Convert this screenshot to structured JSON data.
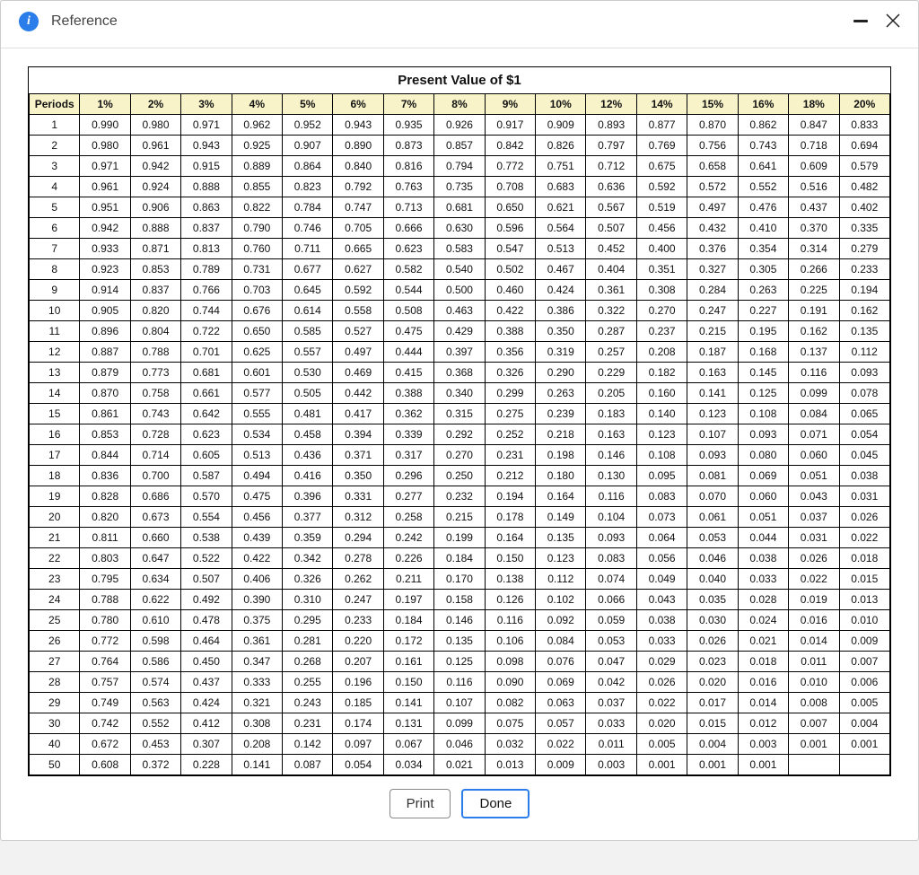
{
  "dialog": {
    "title": "Reference"
  },
  "table": {
    "title": "Present Value of $1",
    "periods_header": "Periods",
    "rates": [
      "1%",
      "2%",
      "3%",
      "4%",
      "5%",
      "6%",
      "7%",
      "8%",
      "9%",
      "10%",
      "12%",
      "14%",
      "15%",
      "16%",
      "18%",
      "20%"
    ],
    "rows": [
      {
        "period": "1",
        "values": [
          "0.990",
          "0.980",
          "0.971",
          "0.962",
          "0.952",
          "0.943",
          "0.935",
          "0.926",
          "0.917",
          "0.909",
          "0.893",
          "0.877",
          "0.870",
          "0.862",
          "0.847",
          "0.833"
        ]
      },
      {
        "period": "2",
        "values": [
          "0.980",
          "0.961",
          "0.943",
          "0.925",
          "0.907",
          "0.890",
          "0.873",
          "0.857",
          "0.842",
          "0.826",
          "0.797",
          "0.769",
          "0.756",
          "0.743",
          "0.718",
          "0.694"
        ]
      },
      {
        "period": "3",
        "values": [
          "0.971",
          "0.942",
          "0.915",
          "0.889",
          "0.864",
          "0.840",
          "0.816",
          "0.794",
          "0.772",
          "0.751",
          "0.712",
          "0.675",
          "0.658",
          "0.641",
          "0.609",
          "0.579"
        ]
      },
      {
        "period": "4",
        "values": [
          "0.961",
          "0.924",
          "0.888",
          "0.855",
          "0.823",
          "0.792",
          "0.763",
          "0.735",
          "0.708",
          "0.683",
          "0.636",
          "0.592",
          "0.572",
          "0.552",
          "0.516",
          "0.482"
        ]
      },
      {
        "period": "5",
        "values": [
          "0.951",
          "0.906",
          "0.863",
          "0.822",
          "0.784",
          "0.747",
          "0.713",
          "0.681",
          "0.650",
          "0.621",
          "0.567",
          "0.519",
          "0.497",
          "0.476",
          "0.437",
          "0.402"
        ]
      },
      {
        "period": "6",
        "values": [
          "0.942",
          "0.888",
          "0.837",
          "0.790",
          "0.746",
          "0.705",
          "0.666",
          "0.630",
          "0.596",
          "0.564",
          "0.507",
          "0.456",
          "0.432",
          "0.410",
          "0.370",
          "0.335"
        ]
      },
      {
        "period": "7",
        "values": [
          "0.933",
          "0.871",
          "0.813",
          "0.760",
          "0.711",
          "0.665",
          "0.623",
          "0.583",
          "0.547",
          "0.513",
          "0.452",
          "0.400",
          "0.376",
          "0.354",
          "0.314",
          "0.279"
        ]
      },
      {
        "period": "8",
        "values": [
          "0.923",
          "0.853",
          "0.789",
          "0.731",
          "0.677",
          "0.627",
          "0.582",
          "0.540",
          "0.502",
          "0.467",
          "0.404",
          "0.351",
          "0.327",
          "0.305",
          "0.266",
          "0.233"
        ]
      },
      {
        "period": "9",
        "values": [
          "0.914",
          "0.837",
          "0.766",
          "0.703",
          "0.645",
          "0.592",
          "0.544",
          "0.500",
          "0.460",
          "0.424",
          "0.361",
          "0.308",
          "0.284",
          "0.263",
          "0.225",
          "0.194"
        ]
      },
      {
        "period": "10",
        "values": [
          "0.905",
          "0.820",
          "0.744",
          "0.676",
          "0.614",
          "0.558",
          "0.508",
          "0.463",
          "0.422",
          "0.386",
          "0.322",
          "0.270",
          "0.247",
          "0.227",
          "0.191",
          "0.162"
        ]
      },
      {
        "period": "11",
        "values": [
          "0.896",
          "0.804",
          "0.722",
          "0.650",
          "0.585",
          "0.527",
          "0.475",
          "0.429",
          "0.388",
          "0.350",
          "0.287",
          "0.237",
          "0.215",
          "0.195",
          "0.162",
          "0.135"
        ]
      },
      {
        "period": "12",
        "values": [
          "0.887",
          "0.788",
          "0.701",
          "0.625",
          "0.557",
          "0.497",
          "0.444",
          "0.397",
          "0.356",
          "0.319",
          "0.257",
          "0.208",
          "0.187",
          "0.168",
          "0.137",
          "0.112"
        ]
      },
      {
        "period": "13",
        "values": [
          "0.879",
          "0.773",
          "0.681",
          "0.601",
          "0.530",
          "0.469",
          "0.415",
          "0.368",
          "0.326",
          "0.290",
          "0.229",
          "0.182",
          "0.163",
          "0.145",
          "0.116",
          "0.093"
        ]
      },
      {
        "period": "14",
        "values": [
          "0.870",
          "0.758",
          "0.661",
          "0.577",
          "0.505",
          "0.442",
          "0.388",
          "0.340",
          "0.299",
          "0.263",
          "0.205",
          "0.160",
          "0.141",
          "0.125",
          "0.099",
          "0.078"
        ]
      },
      {
        "period": "15",
        "values": [
          "0.861",
          "0.743",
          "0.642",
          "0.555",
          "0.481",
          "0.417",
          "0.362",
          "0.315",
          "0.275",
          "0.239",
          "0.183",
          "0.140",
          "0.123",
          "0.108",
          "0.084",
          "0.065"
        ]
      },
      {
        "period": "16",
        "values": [
          "0.853",
          "0.728",
          "0.623",
          "0.534",
          "0.458",
          "0.394",
          "0.339",
          "0.292",
          "0.252",
          "0.218",
          "0.163",
          "0.123",
          "0.107",
          "0.093",
          "0.071",
          "0.054"
        ]
      },
      {
        "period": "17",
        "values": [
          "0.844",
          "0.714",
          "0.605",
          "0.513",
          "0.436",
          "0.371",
          "0.317",
          "0.270",
          "0.231",
          "0.198",
          "0.146",
          "0.108",
          "0.093",
          "0.080",
          "0.060",
          "0.045"
        ]
      },
      {
        "period": "18",
        "values": [
          "0.836",
          "0.700",
          "0.587",
          "0.494",
          "0.416",
          "0.350",
          "0.296",
          "0.250",
          "0.212",
          "0.180",
          "0.130",
          "0.095",
          "0.081",
          "0.069",
          "0.051",
          "0.038"
        ]
      },
      {
        "period": "19",
        "values": [
          "0.828",
          "0.686",
          "0.570",
          "0.475",
          "0.396",
          "0.331",
          "0.277",
          "0.232",
          "0.194",
          "0.164",
          "0.116",
          "0.083",
          "0.070",
          "0.060",
          "0.043",
          "0.031"
        ]
      },
      {
        "period": "20",
        "values": [
          "0.820",
          "0.673",
          "0.554",
          "0.456",
          "0.377",
          "0.312",
          "0.258",
          "0.215",
          "0.178",
          "0.149",
          "0.104",
          "0.073",
          "0.061",
          "0.051",
          "0.037",
          "0.026"
        ]
      },
      {
        "period": "21",
        "values": [
          "0.811",
          "0.660",
          "0.538",
          "0.439",
          "0.359",
          "0.294",
          "0.242",
          "0.199",
          "0.164",
          "0.135",
          "0.093",
          "0.064",
          "0.053",
          "0.044",
          "0.031",
          "0.022"
        ]
      },
      {
        "period": "22",
        "values": [
          "0.803",
          "0.647",
          "0.522",
          "0.422",
          "0.342",
          "0.278",
          "0.226",
          "0.184",
          "0.150",
          "0.123",
          "0.083",
          "0.056",
          "0.046",
          "0.038",
          "0.026",
          "0.018"
        ]
      },
      {
        "period": "23",
        "values": [
          "0.795",
          "0.634",
          "0.507",
          "0.406",
          "0.326",
          "0.262",
          "0.211",
          "0.170",
          "0.138",
          "0.112",
          "0.074",
          "0.049",
          "0.040",
          "0.033",
          "0.022",
          "0.015"
        ]
      },
      {
        "period": "24",
        "values": [
          "0.788",
          "0.622",
          "0.492",
          "0.390",
          "0.310",
          "0.247",
          "0.197",
          "0.158",
          "0.126",
          "0.102",
          "0.066",
          "0.043",
          "0.035",
          "0.028",
          "0.019",
          "0.013"
        ]
      },
      {
        "period": "25",
        "values": [
          "0.780",
          "0.610",
          "0.478",
          "0.375",
          "0.295",
          "0.233",
          "0.184",
          "0.146",
          "0.116",
          "0.092",
          "0.059",
          "0.038",
          "0.030",
          "0.024",
          "0.016",
          "0.010"
        ]
      },
      {
        "period": "26",
        "values": [
          "0.772",
          "0.598",
          "0.464",
          "0.361",
          "0.281",
          "0.220",
          "0.172",
          "0.135",
          "0.106",
          "0.084",
          "0.053",
          "0.033",
          "0.026",
          "0.021",
          "0.014",
          "0.009"
        ]
      },
      {
        "period": "27",
        "values": [
          "0.764",
          "0.586",
          "0.450",
          "0.347",
          "0.268",
          "0.207",
          "0.161",
          "0.125",
          "0.098",
          "0.076",
          "0.047",
          "0.029",
          "0.023",
          "0.018",
          "0.011",
          "0.007"
        ]
      },
      {
        "period": "28",
        "values": [
          "0.757",
          "0.574",
          "0.437",
          "0.333",
          "0.255",
          "0.196",
          "0.150",
          "0.116",
          "0.090",
          "0.069",
          "0.042",
          "0.026",
          "0.020",
          "0.016",
          "0.010",
          "0.006"
        ]
      },
      {
        "period": "29",
        "values": [
          "0.749",
          "0.563",
          "0.424",
          "0.321",
          "0.243",
          "0.185",
          "0.141",
          "0.107",
          "0.082",
          "0.063",
          "0.037",
          "0.022",
          "0.017",
          "0.014",
          "0.008",
          "0.005"
        ]
      },
      {
        "period": "30",
        "values": [
          "0.742",
          "0.552",
          "0.412",
          "0.308",
          "0.231",
          "0.174",
          "0.131",
          "0.099",
          "0.075",
          "0.057",
          "0.033",
          "0.020",
          "0.015",
          "0.012",
          "0.007",
          "0.004"
        ]
      },
      {
        "period": "40",
        "values": [
          "0.672",
          "0.453",
          "0.307",
          "0.208",
          "0.142",
          "0.097",
          "0.067",
          "0.046",
          "0.032",
          "0.022",
          "0.011",
          "0.005",
          "0.004",
          "0.003",
          "0.001",
          "0.001"
        ]
      },
      {
        "period": "50",
        "values": [
          "0.608",
          "0.372",
          "0.228",
          "0.141",
          "0.087",
          "0.054",
          "0.034",
          "0.021",
          "0.013",
          "0.009",
          "0.003",
          "0.001",
          "0.001",
          "0.001",
          "",
          ""
        ]
      }
    ],
    "group_breaks": [
      5,
      10,
      15,
      20,
      25,
      30,
      31
    ]
  },
  "buttons": {
    "print": "Print",
    "done": "Done"
  }
}
